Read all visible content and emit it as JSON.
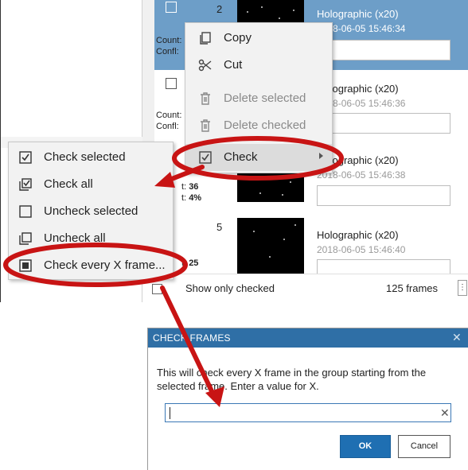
{
  "list": {
    "rows": [
      {
        "number": "2",
        "name": "Holographic (x20)",
        "timestamp": "2018-06-05 15:46:34",
        "count_label": "Count:",
        "confl_label": "Confl:",
        "selected": true
      },
      {
        "number": "",
        "name": "Holographic (x20)",
        "timestamp": "2018-06-05 15:46:36",
        "count_label": "Count:",
        "confl_label": "Confl:",
        "selected": false
      },
      {
        "number": "",
        "name": "Holographic (x20)",
        "timestamp": "2018-06-05 15:46:38",
        "count_label": "t:",
        "count_value": "36",
        "confl_label": "t:",
        "confl_value": "4%",
        "selected": false
      },
      {
        "number": "5",
        "name": "Holographic (x20)",
        "timestamp": "2018-06-05 15:46:40",
        "count_label": "t:",
        "count_value": "25",
        "selected": false
      }
    ]
  },
  "footer": {
    "show_only_checked_label": "Show only checked",
    "frames_count": "125 frames",
    "more_glyph": "⋮"
  },
  "context_menu": {
    "items": [
      {
        "label": "Copy",
        "icon": "copy-icon",
        "glyph": "⧉",
        "disabled": false
      },
      {
        "label": "Cut",
        "icon": "scissors-icon",
        "glyph": "✂",
        "disabled": false
      },
      {
        "label": "Delete selected",
        "icon": "trash-icon",
        "glyph": "🗑",
        "disabled": true
      },
      {
        "label": "Delete checked",
        "icon": "trash-icon",
        "glyph": "🗑",
        "disabled": true
      },
      {
        "label": "Check",
        "icon": "checkbox-checked-icon",
        "glyph": "☑",
        "disabled": false,
        "submenu": true
      }
    ]
  },
  "check_submenu": {
    "items": [
      {
        "label": "Check selected",
        "icon": "check-selected-icon"
      },
      {
        "label": "Check all",
        "icon": "check-all-icon"
      },
      {
        "label": "Uncheck selected",
        "icon": "uncheck-selected-icon"
      },
      {
        "label": "Uncheck all",
        "icon": "uncheck-all-icon"
      },
      {
        "label": "Check every X frame...",
        "icon": "check-every-x-icon"
      }
    ]
  },
  "dialog": {
    "title": "CHECK FRAMES",
    "close_glyph": "✕",
    "message": "This will check every X frame in the group starting from the selected frame. Enter a value for X.",
    "input_value": "",
    "clear_glyph": "✕",
    "ok_label": "OK",
    "cancel_label": "Cancel"
  },
  "colors": {
    "annotation_red": "#c81414",
    "selection_blue": "#6d9ec8",
    "dialog_title_blue": "#2f6fa6",
    "ok_button_blue": "#1f6fb2"
  }
}
